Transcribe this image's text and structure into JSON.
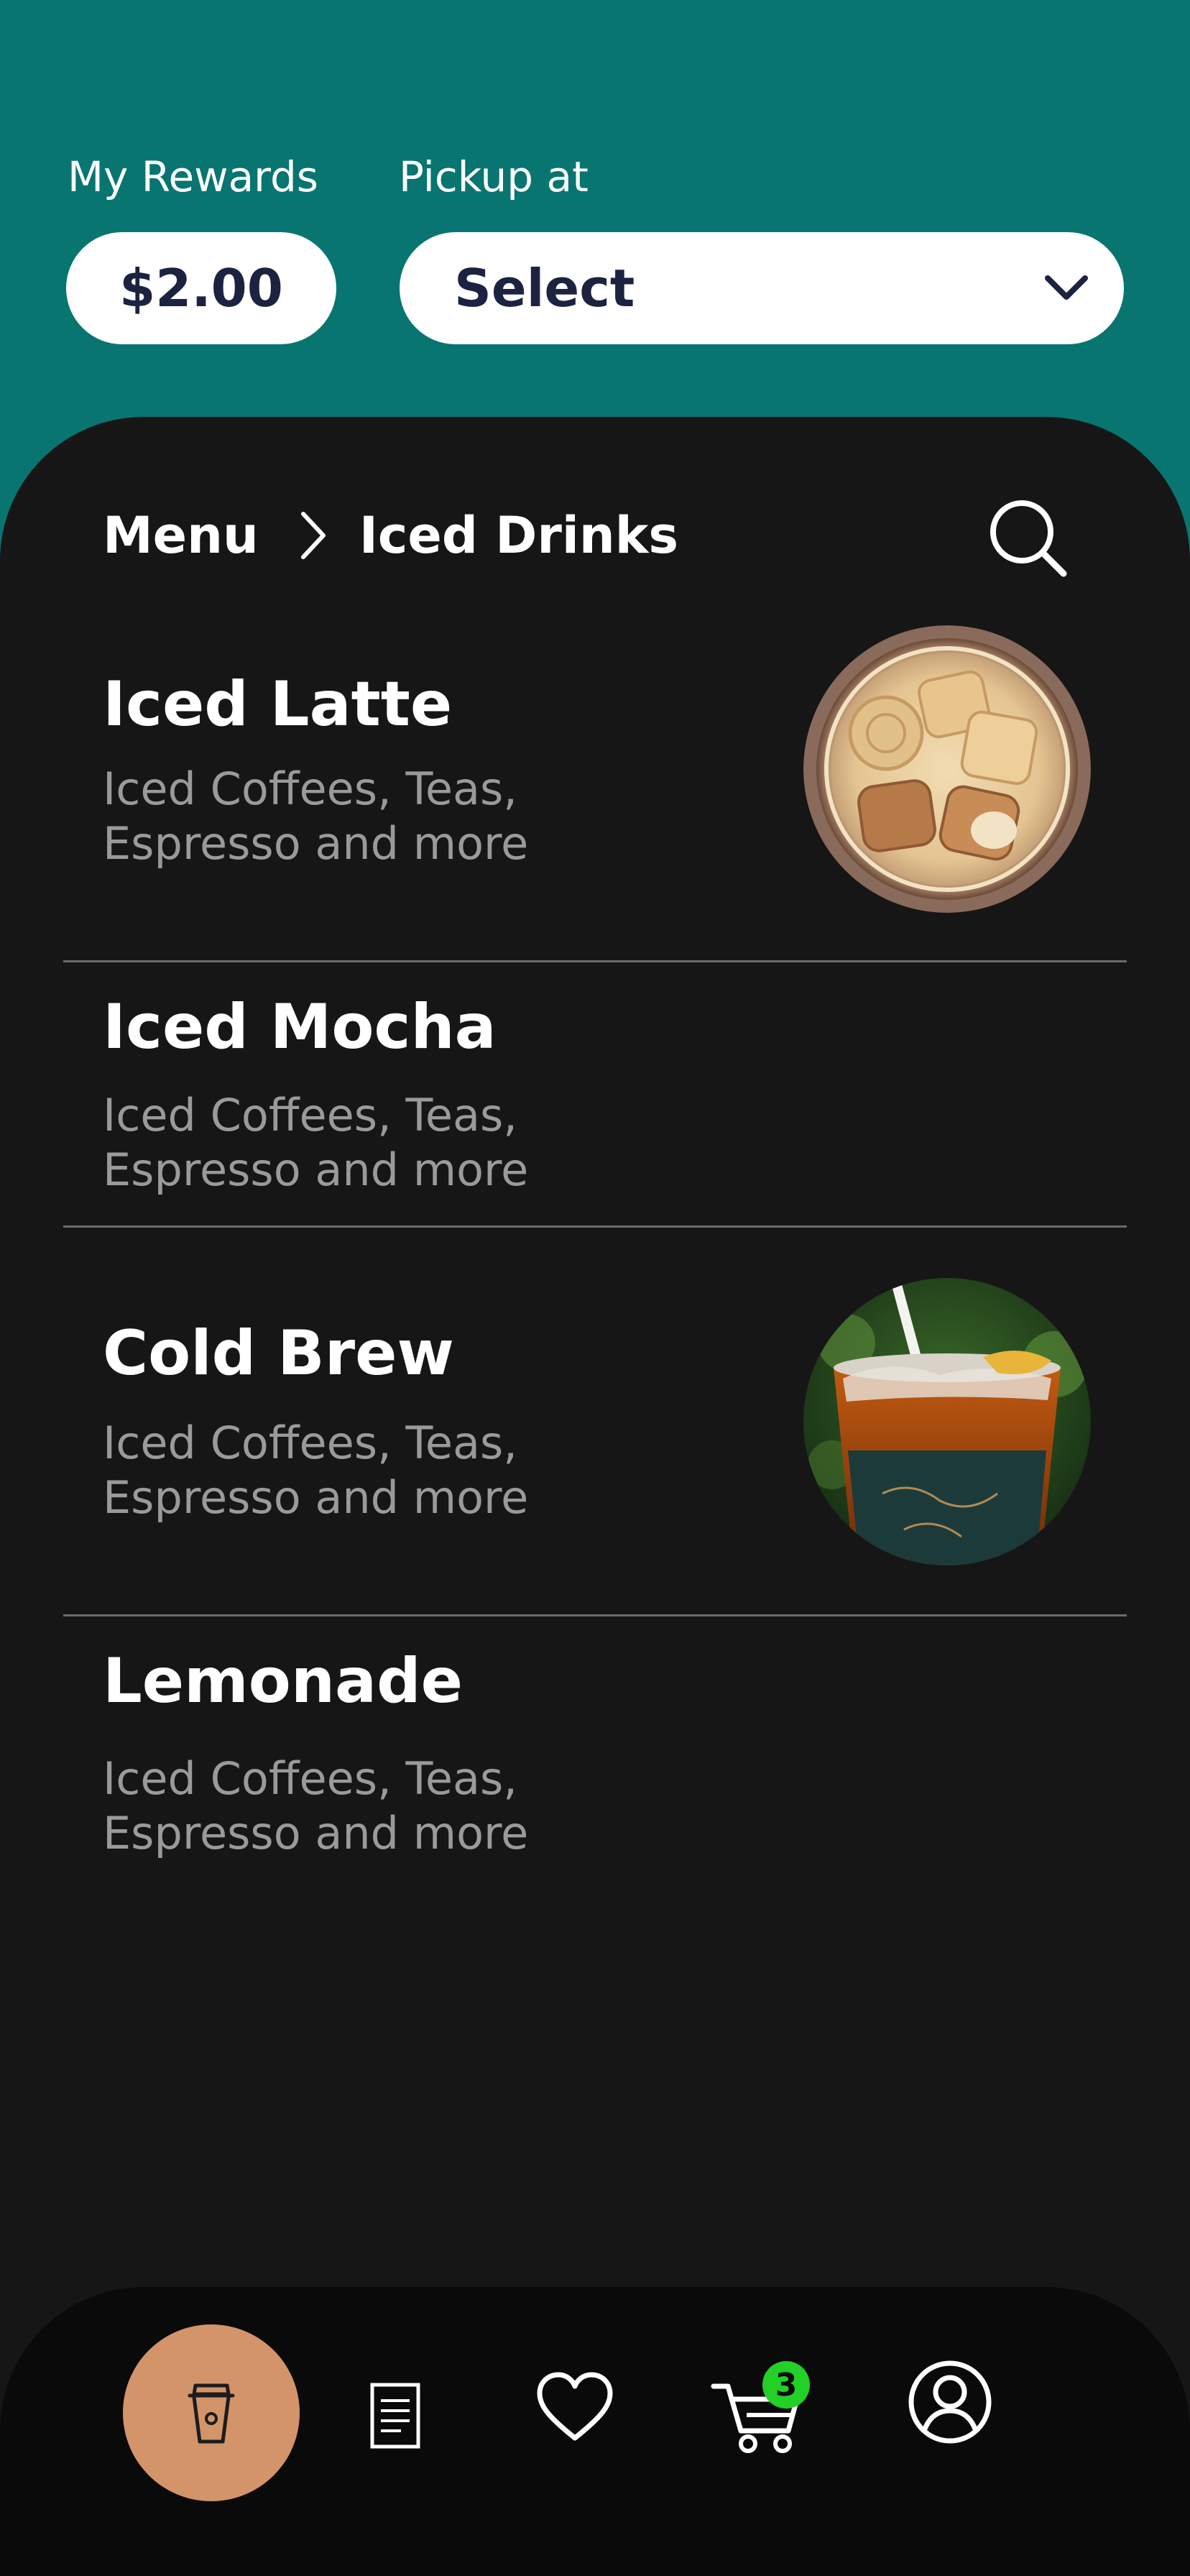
{
  "header": {
    "rewards_label": "My Rewards",
    "rewards_value": "$2.00",
    "pickup_label": "Pickup at",
    "pickup_value": "Select",
    "pickup_icon": "chevron-down-icon"
  },
  "breadcrumb": {
    "root": "Menu",
    "separator_icon": "chevron-right-icon",
    "current": "Iced Drinks",
    "search_icon": "search-icon"
  },
  "items": [
    {
      "title": "Iced Latte",
      "desc": "Iced Coffees, Teas, Espresso and more",
      "image": "iced-latte-photo"
    },
    {
      "title": "Iced Mocha",
      "desc": "Iced Coffees, Teas, Espresso and more"
    },
    {
      "title": "Cold Brew",
      "desc": "Iced Coffees, Teas, Espresso and more",
      "image": "cold-brew-photo"
    },
    {
      "title": "Lemonade",
      "desc": "Iced Coffees, Teas, Espresso and more"
    }
  ],
  "nav": {
    "items": [
      "drinks-cup-icon",
      "menu-document-icon",
      "heart-icon",
      "cart-icon",
      "profile-icon"
    ],
    "active": "drinks-cup-icon",
    "cart_count": "3"
  },
  "colors": {
    "header_bg": "#087570",
    "panel_bg": "#161617",
    "nav_bg": "#0a0a0b",
    "active_nav": "#d39469",
    "badge": "#22d026",
    "pill_text": "#1c2340"
  }
}
